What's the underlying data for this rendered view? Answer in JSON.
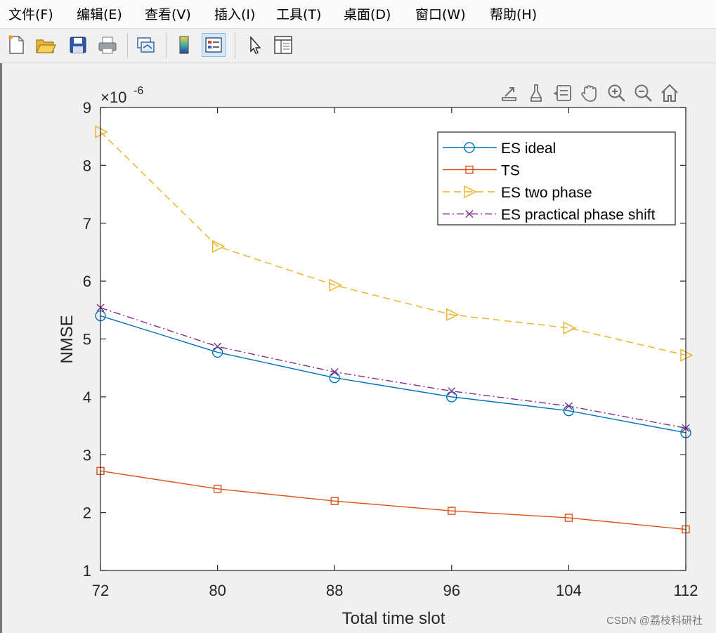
{
  "menu": {
    "items": [
      "文件(F)",
      "编辑(E)",
      "查看(V)",
      "插入(I)",
      "工具(T)",
      "桌面(D)",
      "窗口(W)",
      "帮助(H)"
    ]
  },
  "toolbar": {
    "buttons": [
      "new-figure-icon",
      "open-file-icon",
      "save-icon",
      "print-icon",
      "link-plot-icon",
      "insert-colorbar-icon",
      "insert-legend-icon",
      "edit-plot-icon",
      "property-inspector-icon"
    ]
  },
  "axes_toolbar": {
    "buttons": [
      "export-icon",
      "brush-icon",
      "data-tips-icon",
      "pan-icon",
      "zoom-in-icon",
      "zoom-out-icon",
      "restore-view-icon"
    ]
  },
  "watermark": "CSDN @荔枝科研社",
  "chart_data": {
    "type": "line",
    "x": [
      72,
      80,
      88,
      96,
      104,
      112
    ],
    "xlabel": "Total time slot",
    "ylabel": "NMSE",
    "xlim": [
      72,
      112
    ],
    "ylim": [
      1,
      9
    ],
    "xticks": [
      "72",
      "80",
      "88",
      "96",
      "104",
      "112"
    ],
    "yticks": [
      "1",
      "2",
      "3",
      "4",
      "5",
      "6",
      "7",
      "8",
      "9"
    ],
    "y_exponent_label": "×10",
    "y_exponent": "-6",
    "grid": false,
    "legend_position": "top-right",
    "series": [
      {
        "name": "ES ideal",
        "values": [
          5.4,
          4.77,
          4.33,
          4.0,
          3.76,
          3.38
        ],
        "color": "#0072BD",
        "marker": "circle",
        "dash": "solid"
      },
      {
        "name": "TS",
        "values": [
          2.72,
          2.41,
          2.2,
          2.03,
          1.91,
          1.71
        ],
        "color": "#D95319",
        "marker": "square",
        "dash": "solid"
      },
      {
        "name": "ES two phase",
        "values": [
          8.58,
          6.6,
          5.93,
          5.42,
          5.19,
          4.72
        ],
        "color": "#EDB120",
        "marker": "triangle-right",
        "dash": "dashed"
      },
      {
        "name": "ES practical phase shift",
        "values": [
          5.54,
          4.87,
          4.43,
          4.1,
          3.84,
          3.46
        ],
        "color": "#7E2F8E",
        "marker": "x",
        "dash": "dashdot"
      }
    ]
  }
}
